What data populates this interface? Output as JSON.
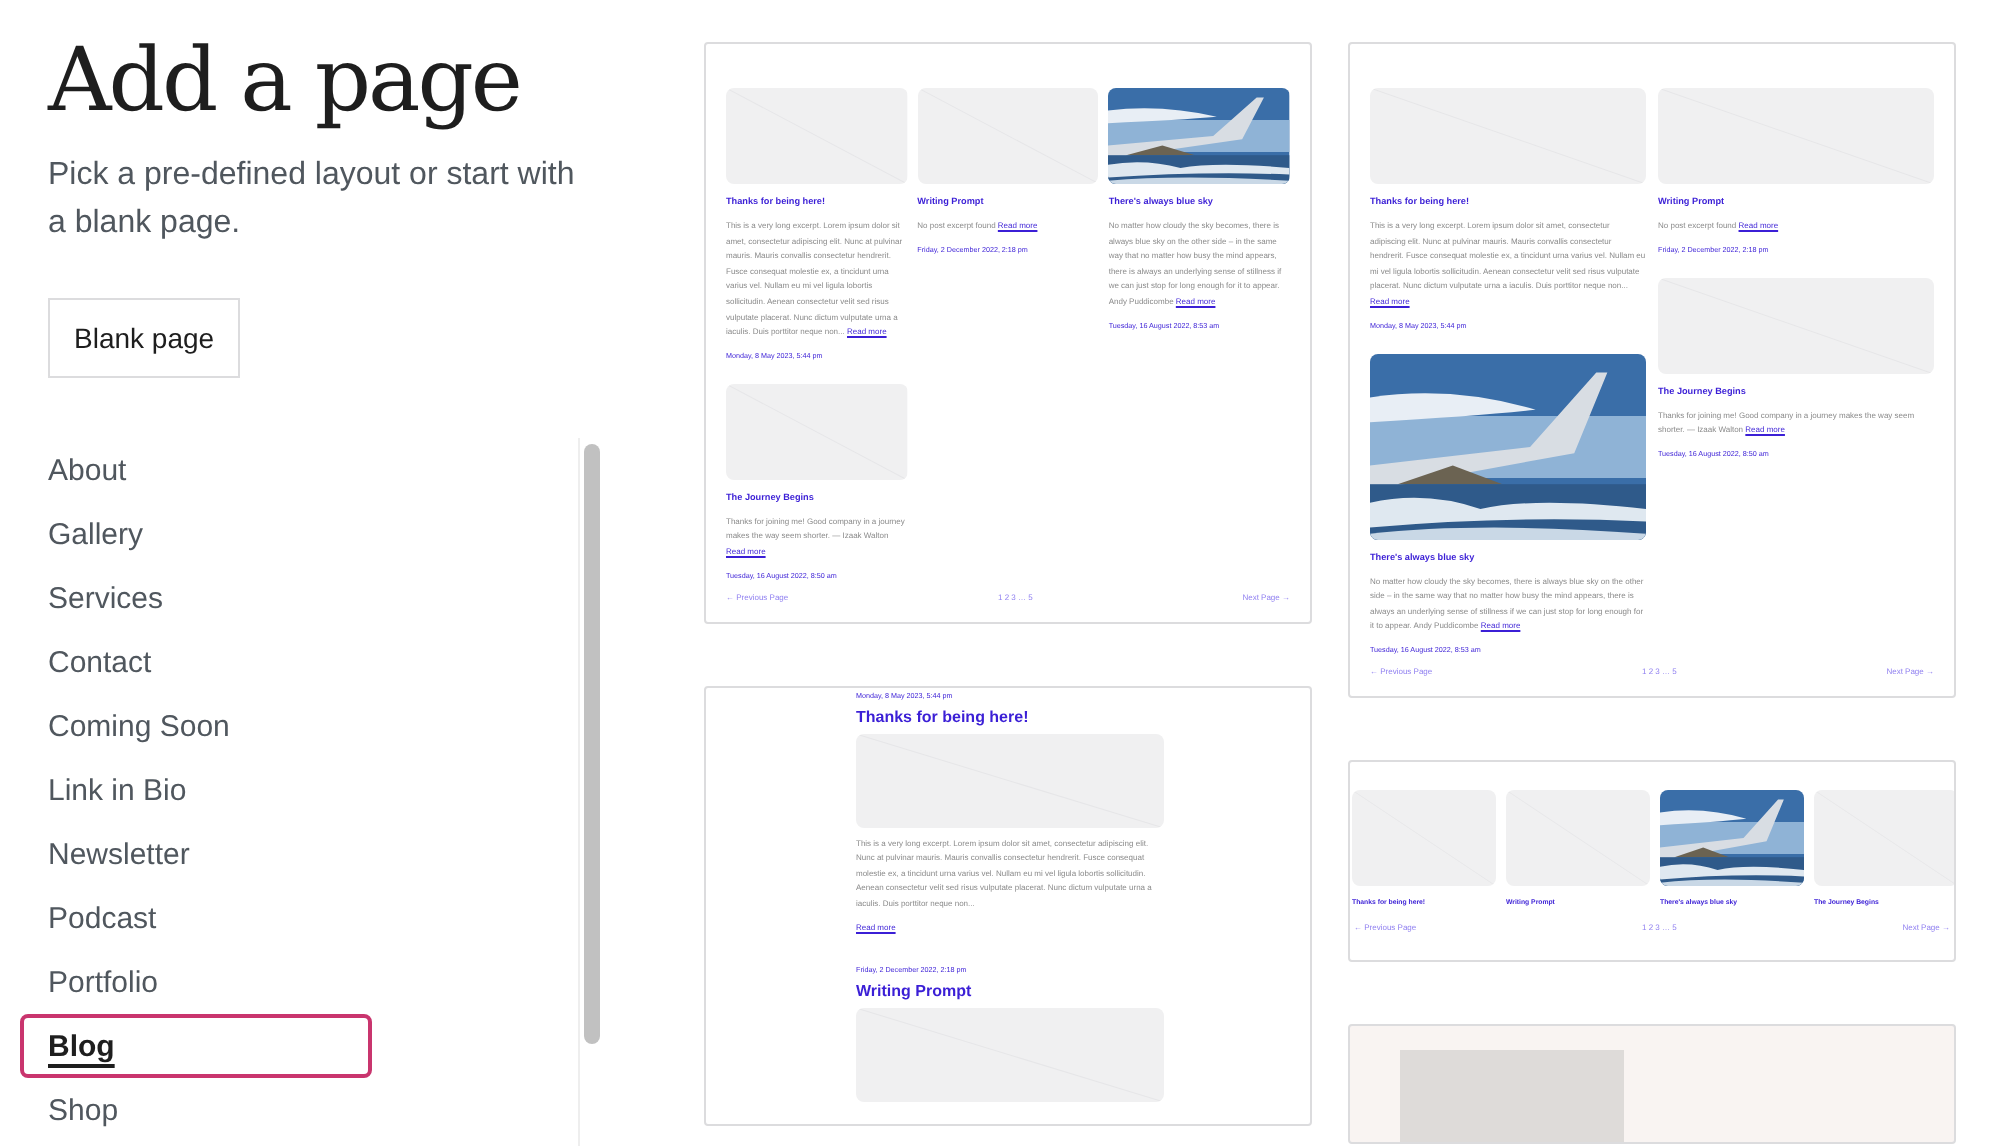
{
  "header": {
    "title": "Add a page",
    "subtitle": "Pick a pre-defined layout or start with a blank page.",
    "blank_button": "Blank page"
  },
  "categories": [
    {
      "label": "About",
      "selected": false
    },
    {
      "label": "Gallery",
      "selected": false
    },
    {
      "label": "Services",
      "selected": false
    },
    {
      "label": "Contact",
      "selected": false
    },
    {
      "label": "Coming Soon",
      "selected": false
    },
    {
      "label": "Link in Bio",
      "selected": false
    },
    {
      "label": "Newsletter",
      "selected": false
    },
    {
      "label": "Podcast",
      "selected": false
    },
    {
      "label": "Portfolio",
      "selected": false
    },
    {
      "label": "Blog",
      "selected": true
    },
    {
      "label": "Shop",
      "selected": false
    }
  ],
  "previews": [
    {
      "kind": "grid3",
      "posts": [
        {
          "title": "Thanks for being here!",
          "kind": "placeholder",
          "excerpt": "This is a very long excerpt. Lorem ipsum dolor sit amet, consectetur adipiscing elit. Nunc at pulvinar mauris. Mauris convallis consectetur hendrerit. Fusce consequat molestie ex, a tincidunt urna varius vel. Nullam eu mi vel ligula lobortis sollicitudin. Aenean consectetur velit sed risus vulputate placerat. Nunc dictum vulputate urna a iaculis. Duis porttitor neque non...",
          "read_more": "Read more",
          "date": "Monday, 8 May 2023, 5:44 pm"
        },
        {
          "title": "Writing Prompt",
          "kind": "placeholder",
          "excerpt": "No post excerpt found",
          "read_more": "Read more",
          "date": "Friday, 2 December 2022, 2:18 pm"
        },
        {
          "title": "There's always blue sky",
          "excerpt": "No matter how cloudy the sky becomes, there is always blue sky on the other side – in the same way that no matter how busy the mind appears, there is always an underlying sense of stillness if we can just stop for long enough for it to appear. Andy Puddicombe",
          "read_more": "Read more",
          "date": "Tuesday, 16 August 2022, 8:53 am"
        },
        {
          "title": "The Journey Begins",
          "kind": "placeholder",
          "excerpt": "Thanks for joining me! Good company in a journey makes the way seem shorter. — Izaak Walton",
          "read_more": "Read more",
          "date": "Tuesday, 16 August 2022, 8:50 am"
        }
      ],
      "pagination": {
        "previous": "← Previous Page",
        "pages": "1 2 3 … 5",
        "next": "Next Page →"
      }
    },
    {
      "kind": "grid2",
      "posts": [
        {
          "title": "Thanks for being here!",
          "kind": "placeholder",
          "excerpt": "This is a very long excerpt. Lorem ipsum dolor sit amet, consectetur adipiscing elit. Nunc at pulvinar mauris. Mauris convallis consectetur hendrerit. Fusce consequat molestie ex, a tincidunt urna varius vel. Nullam eu mi vel ligula lobortis sollicitudin. Aenean consectetur velit sed risus vulputate placerat. Nunc dictum vulputate urna a iaculis. Duis porttitor neque non...",
          "read_more": "Read more",
          "date": "Monday, 8 May 2023, 5:44 pm"
        },
        {
          "title": "There's always blue sky",
          "excerpt": "No matter how cloudy the sky becomes, there is always blue sky on the other side – in the same way that no matter how busy the mind appears, there is always an underlying sense of stillness if we can just stop for long enough for it to appear. Andy Puddicombe",
          "read_more": "Read more",
          "date": "Tuesday, 16 August 2022, 8:53 am"
        },
        {
          "title": "Writing Prompt",
          "kind": "placeholder",
          "excerpt": "No post excerpt found",
          "read_more": "Read more",
          "date": "Friday, 2 December 2022, 2:18 pm"
        },
        {
          "title": "The Journey Begins",
          "kind": "placeholder",
          "excerpt": "Thanks for joining me! Good company in a journey makes the way seem shorter. — Izaak Walton",
          "read_more": "Read more",
          "date": "Tuesday, 16 August 2022, 8:50 am"
        }
      ],
      "pagination": {
        "previous": "← Previous Page",
        "pages": "1 2 3 … 5",
        "next": "Next Page →"
      }
    },
    {
      "kind": "list",
      "posts": [
        {
          "title": "Thanks for being here!",
          "kind": "placeholder",
          "excerpt": "This is a very long excerpt. Lorem ipsum dolor sit amet, consectetur adipiscing elit. Nunc at pulvinar mauris. Mauris convallis consectetur hendrerit. Fusce consequat molestie ex, a tincidunt urna varius vel. Nullam eu mi vel ligula lobortis sollicitudin. Aenean consectetur velit sed risus vulputate placerat. Nunc dictum vulputate urna a iaculis. Duis porttitor neque non...",
          "read_more": "Read more",
          "date": "Monday, 8 May 2023, 5:44 pm"
        },
        {
          "title": "Writing Prompt",
          "kind": "placeholder",
          "date": "Friday, 2 December 2022, 2:18 pm"
        }
      ]
    },
    {
      "kind": "carousel",
      "posts": [
        {
          "title": "Thanks for being here!",
          "kind": "placeholder"
        },
        {
          "title": "Writing Prompt",
          "kind": "placeholder"
        },
        {
          "title": "There's always blue sky"
        },
        {
          "title": "The Journey Begins",
          "kind": "placeholder"
        }
      ],
      "pagination": {
        "previous": "← Previous Page",
        "pages": "1 2 3 … 5",
        "next": "Next Page →"
      }
    },
    {
      "kind": "cover"
    }
  ]
}
